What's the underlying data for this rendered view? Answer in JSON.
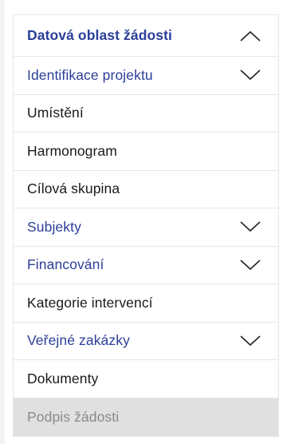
{
  "menu": {
    "items": [
      {
        "label": "Datová oblast žádosti",
        "kind": "header",
        "icon": "chevron-up-icon"
      },
      {
        "label": "Identifikace projektu",
        "kind": "section",
        "icon": "chevron-down-icon"
      },
      {
        "label": "Umístění",
        "kind": "link"
      },
      {
        "label": "Harmonogram",
        "kind": "link"
      },
      {
        "label": "Cílová skupina",
        "kind": "link"
      },
      {
        "label": "Subjekty",
        "kind": "section",
        "icon": "chevron-down-icon"
      },
      {
        "label": "Financování",
        "kind": "section",
        "icon": "chevron-down-icon"
      },
      {
        "label": "Kategorie intervencí",
        "kind": "link"
      },
      {
        "label": "Veřejné zakázky",
        "kind": "section",
        "icon": "chevron-down-icon"
      },
      {
        "label": "Dokumenty",
        "kind": "link"
      },
      {
        "label": "Podpis žádosti",
        "kind": "disabled"
      }
    ]
  },
  "colors": {
    "section_text": "#2b3f99",
    "disabled_bg": "#e0e0e0",
    "disabled_text": "#8a8a8a"
  }
}
